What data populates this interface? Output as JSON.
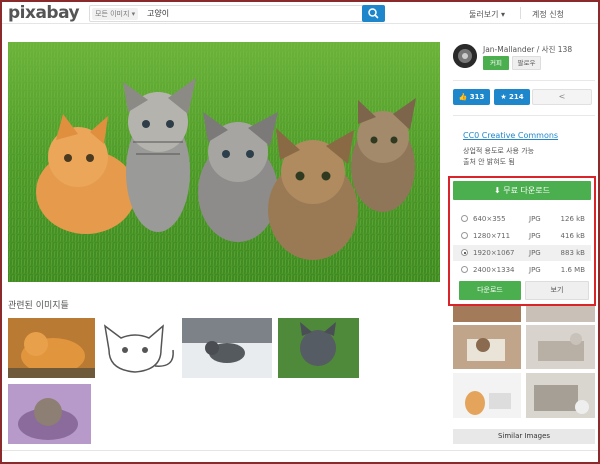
{
  "header": {
    "logo": "pixabay",
    "search_scope": "모든 이미지 ▾",
    "search_value": "고양이",
    "explore_label": "둘러보기 ▾",
    "signup_label": "계정 신청"
  },
  "main": {
    "image_subject": "five kittens on grass",
    "related_title": "관련된 이미지들"
  },
  "author": {
    "name_line": "Jan-Mallander / 사진 138",
    "coffee_label": "커피",
    "follow_label": "팔로우"
  },
  "stats": {
    "likes": "313",
    "favorites": "214"
  },
  "license": {
    "link": "CC0 Creative Commons",
    "line1": "상업적 용도로 사용 가능",
    "line2": "출처 안 밝혀도 됨"
  },
  "download": {
    "free_label": "무료 다운로드",
    "options": [
      {
        "res": "640×355",
        "fmt": "JPG",
        "size": "126 kB",
        "selected": false
      },
      {
        "res": "1280×711",
        "fmt": "JPG",
        "size": "416 kB",
        "selected": false
      },
      {
        "res": "1920×1067",
        "fmt": "JPG",
        "size": "883 kB",
        "selected": true
      },
      {
        "res": "2400×1334",
        "fmt": "JPG",
        "size": "1.6 MB",
        "selected": false
      }
    ],
    "download_label": "다운로드",
    "view_label": "보기"
  },
  "similar_label": "Similar Images",
  "colors": {
    "accent_blue": "#1e87cc",
    "green": "#4bae4f",
    "highlight_red": "#d9252a"
  }
}
